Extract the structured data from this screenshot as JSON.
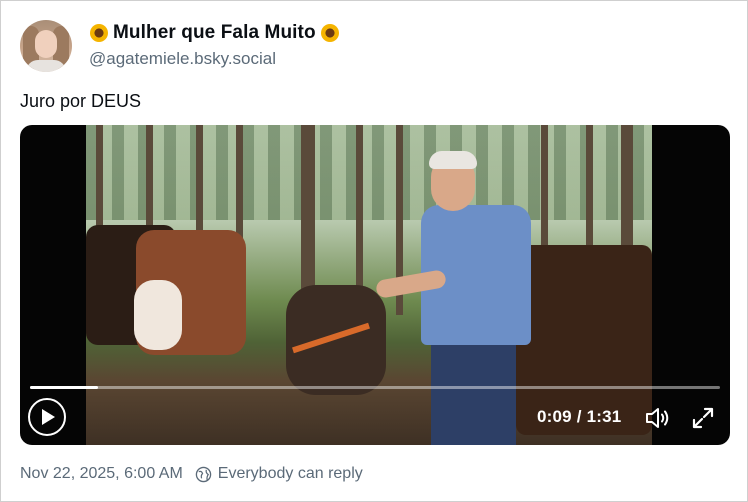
{
  "author": {
    "display_name": "Mulher que Fala Muito",
    "handle": "@agatemiele.bsky.social",
    "name_decoration_icon": "sunflower-emoji"
  },
  "post": {
    "text": "Juro por DEUS",
    "timestamp": "Nov 22, 2025, 6:00 AM",
    "reply_setting": "Everybody can reply"
  },
  "video": {
    "current_time": "0:09",
    "duration": "1:31",
    "time_display": "0:09 / 1:31",
    "progress_fraction": 0.099,
    "icons": {
      "play": "play-icon",
      "volume": "volume-icon",
      "fullscreen": "fullscreen-icon"
    }
  },
  "colors": {
    "text_primary": "#0b0f14",
    "text_secondary": "#5b6a78",
    "border": "#cfcfcf"
  }
}
